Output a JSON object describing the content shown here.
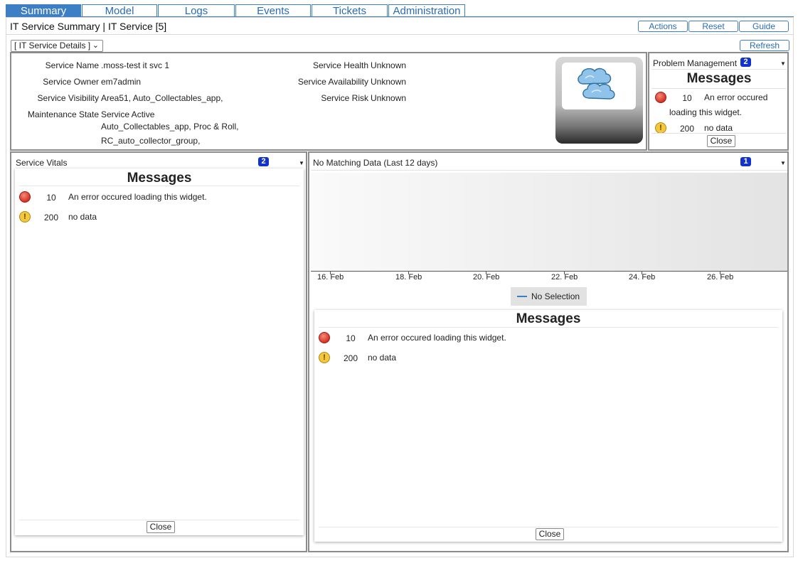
{
  "tabs": [
    {
      "label": "Summary",
      "active": true
    },
    {
      "label": "Model",
      "active": false
    },
    {
      "label": "Logs",
      "active": false
    },
    {
      "label": "Events",
      "active": false
    },
    {
      "label": "Tickets",
      "active": false
    },
    {
      "label": "Administration",
      "active": false
    }
  ],
  "header": {
    "title": "IT Service Summary | IT Service [5]",
    "actions_label": "Actions",
    "reset_label": "Reset",
    "guide_label": "Guide",
    "refresh_label": "Refresh",
    "selector_value": "[ IT Service Details ]"
  },
  "details": {
    "service_name_label": "Service Name",
    "service_name_value": ".moss-test it svc 1",
    "service_owner_label": "Service Owner",
    "service_owner_value": "em7admin",
    "service_visibility_label": "Service Visibility",
    "service_visibility_value": "Area51, Auto_Collectables_app,",
    "maintenance_state_label": "Maintenance State",
    "maintenance_state_value": "Service Active",
    "extra_line_1": "Auto_Collectables_app, Proc & Roll,",
    "extra_line_2": "RC_auto_collector_group,",
    "service_health_label": "Service Health",
    "service_health_value": "Unknown",
    "service_availability_label": "Service Availability",
    "service_availability_value": "Unknown",
    "service_risk_label": "Service Risk",
    "service_risk_value": "Unknown",
    "service_icon": "cloud-icon"
  },
  "problem_management": {
    "title": "Problem Management",
    "badge": "2",
    "messages_title": "Messages",
    "error_count": "10",
    "error_text_1": "An error occured",
    "error_text_2": "loading this widget.",
    "warn_count": "200",
    "warn_text": "no data",
    "close_label": "Close"
  },
  "service_vitals": {
    "title": "Service Vitals",
    "badge": "2",
    "messages_title": "Messages",
    "error_count": "10",
    "error_text": "An error occured loading this widget.",
    "warn_count": "200",
    "warn_text": "no data",
    "close_label": "Close"
  },
  "no_matching": {
    "title": "No Matching Data (Last 12 days)",
    "badge": "1",
    "legend_label": "No Selection",
    "messages_title": "Messages",
    "error_count": "10",
    "error_text": "An error occured loading this widget.",
    "warn_count": "200",
    "warn_text": "no data",
    "close_label": "Close"
  },
  "chart_data": {
    "type": "line",
    "title": "",
    "xlabel": "",
    "ylabel": "",
    "x_ticks": [
      "16. Feb",
      "18. Feb",
      "20. Feb",
      "22. Feb",
      "24. Feb",
      "26. Feb"
    ],
    "series": [
      {
        "name": "No Selection",
        "values": []
      }
    ],
    "grid": false,
    "legend_position": "bottom-center"
  },
  "colors": {
    "accent": "#3d7fc4",
    "badge": "#1133cc",
    "error": "#d9382a",
    "warning": "#f4c73c",
    "panel_border": "#8c8c8c"
  }
}
